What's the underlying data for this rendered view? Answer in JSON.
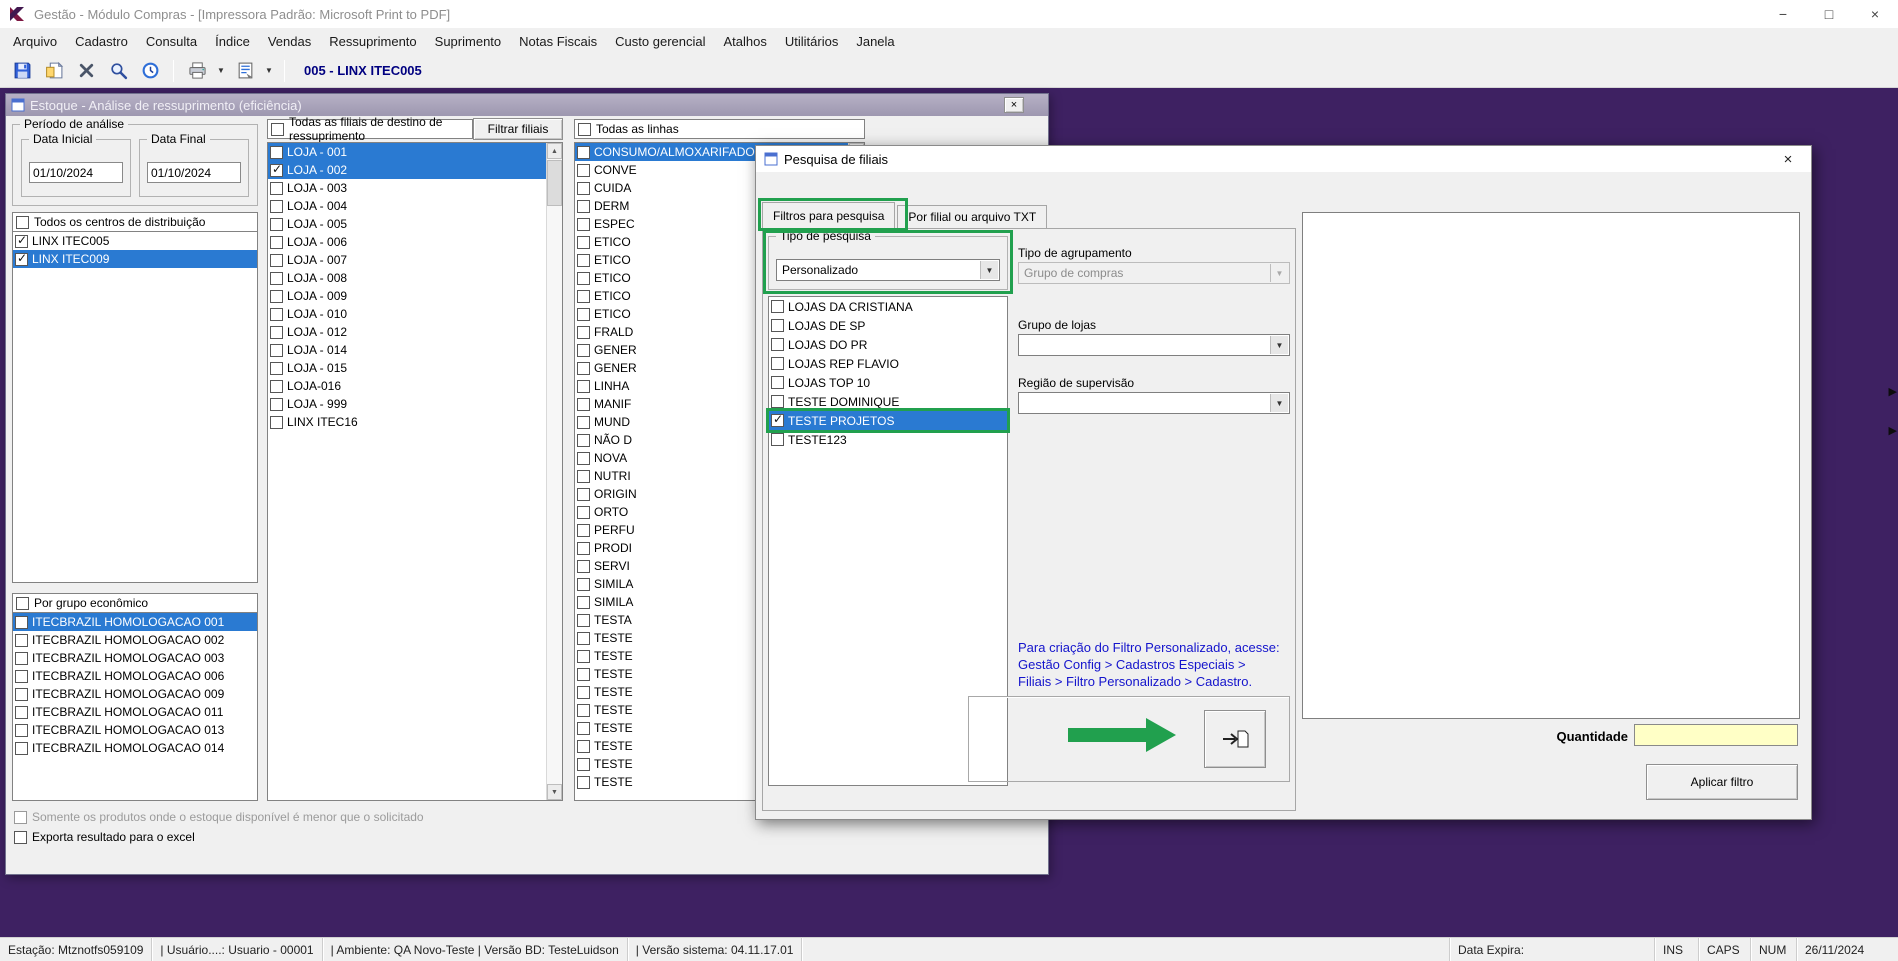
{
  "colors": {
    "accent_blue": "#2a7ad2",
    "annotation_green": "#21a04e",
    "desktop_purple": "#3e2162",
    "hint_blue": "#1414cc",
    "highlight_yellow": "#ffffc6"
  },
  "icons": {
    "minimize": "−",
    "maximize": "□",
    "close": "×",
    "scroll_up": "▲",
    "scroll_down": "▼",
    "dropdown": "▼",
    "edge_arrow": "▶"
  },
  "titlebar": {
    "title": "Gestão  - Módulo Compras - [Impressora Padrão: Microsoft Print to PDF]"
  },
  "menubar": {
    "items": [
      "Arquivo",
      "Cadastro",
      "Consulta",
      "Índice",
      "Vendas",
      "Ressuprimento",
      "Suprimento",
      "Notas Fiscais",
      "Custo gerencial",
      "Atalhos",
      "Utilitários",
      "Janela"
    ]
  },
  "toolbar": {
    "store_label": "005 - LINX ITEC005"
  },
  "analysis_dialog": {
    "title": "Estoque - Análise de ressuprimento (eficiência)",
    "periodo": {
      "group_label": "Período de análise",
      "data_inicial_label": "Data Inicial",
      "data_inicial_value": "01/10/2024",
      "data_final_label": "Data Final",
      "data_final_value": "01/10/2024"
    },
    "centros": {
      "header": "Todos os centros de distribuição",
      "items": [
        {
          "label": "LINX ITEC005",
          "checked": true
        },
        {
          "label": "LINX ITEC009",
          "checked": true,
          "selected": true
        }
      ]
    },
    "filiais": {
      "header": "Todas as filiais de destino de ressuprimento",
      "filter_button": "Filtrar filiais",
      "items": [
        {
          "label": "LOJA - 001",
          "selected": true
        },
        {
          "label": "LOJA - 002",
          "checked": true,
          "selected": true
        },
        {
          "label": "LOJA - 003"
        },
        {
          "label": "LOJA - 004"
        },
        {
          "label": "LOJA - 005"
        },
        {
          "label": "LOJA - 006"
        },
        {
          "label": "LOJA - 007"
        },
        {
          "label": "LOJA - 008"
        },
        {
          "label": "LOJA - 009"
        },
        {
          "label": "LOJA - 010"
        },
        {
          "label": "LOJA - 012"
        },
        {
          "label": "LOJA - 014"
        },
        {
          "label": "LOJA - 015"
        },
        {
          "label": "LOJA-016"
        },
        {
          "label": "LOJA - 999"
        },
        {
          "label": "LINX ITEC16"
        }
      ]
    },
    "linhas": {
      "header": "Todas as linhas",
      "items": [
        {
          "label": "CONSUMO/ALMOXARIFADO",
          "selected": true
        },
        {
          "label": "CONVE"
        },
        {
          "label": "CUIDA"
        },
        {
          "label": "DERM"
        },
        {
          "label": "ESPEC"
        },
        {
          "label": "ETICO"
        },
        {
          "label": "ETICO"
        },
        {
          "label": "ETICO"
        },
        {
          "label": "ETICO"
        },
        {
          "label": "ETICO"
        },
        {
          "label": "FRALD"
        },
        {
          "label": "GENER"
        },
        {
          "label": "GENER"
        },
        {
          "label": "LINHA"
        },
        {
          "label": "MANIF"
        },
        {
          "label": "MUND"
        },
        {
          "label": "NÃO D"
        },
        {
          "label": "NOVA"
        },
        {
          "label": "NUTRI"
        },
        {
          "label": "ORIGIN"
        },
        {
          "label": "ORTO"
        },
        {
          "label": "PERFU"
        },
        {
          "label": "PRODI"
        },
        {
          "label": "SERVI"
        },
        {
          "label": "SIMILA"
        },
        {
          "label": "SIMILA"
        },
        {
          "label": "TESTA"
        },
        {
          "label": "TESTE"
        },
        {
          "label": "TESTE"
        },
        {
          "label": "TESTE"
        },
        {
          "label": "TESTE"
        },
        {
          "label": "TESTE"
        },
        {
          "label": "TESTE"
        },
        {
          "label": "TESTE"
        },
        {
          "label": "TESTE"
        },
        {
          "label": "TESTE"
        }
      ]
    },
    "grupos": {
      "header": "Por grupo econômico",
      "items": [
        {
          "label": "ITECBRAZIL HOMOLOGACAO 001",
          "selected": true
        },
        {
          "label": "ITECBRAZIL HOMOLOGACAO 002"
        },
        {
          "label": "ITECBRAZIL HOMOLOGACAO 003"
        },
        {
          "label": "ITECBRAZIL HOMOLOGACAO 006"
        },
        {
          "label": "ITECBRAZIL HOMOLOGACAO 009"
        },
        {
          "label": "ITECBRAZIL HOMOLOGACAO 011"
        },
        {
          "label": "ITECBRAZIL HOMOLOGACAO 013"
        },
        {
          "label": "ITECBRAZIL HOMOLOGACAO 014"
        }
      ]
    },
    "footer": {
      "check1": "Somente os produtos onde o estoque disponível é menor que o solicitado",
      "check2": "Exporta resultado para o excel"
    }
  },
  "filter_dialog": {
    "title": "Pesquisa de filiais",
    "tabs": [
      {
        "label": "Filtros para pesquisa",
        "active": true
      },
      {
        "label": "Por filial ou arquivo TXT"
      }
    ],
    "tipo_pesquisa": {
      "group_label": "Tipo de pesquisa",
      "value": "Personalizado"
    },
    "filters": [
      {
        "label": "LOJAS DA CRISTIANA"
      },
      {
        "label": "LOJAS DE SP"
      },
      {
        "label": "LOJAS DO PR"
      },
      {
        "label": "LOJAS REP FLAVIO"
      },
      {
        "label": "LOJAS TOP 10"
      },
      {
        "label": "TESTE DOMINIQUE"
      },
      {
        "label": "TESTE PROJETOS",
        "checked": true,
        "selected": true,
        "annotated": true
      },
      {
        "label": "TESTE123"
      }
    ],
    "agrupamento_label": "Tipo de agrupamento",
    "agrupamento_value": "Grupo de compras",
    "grupo_lojas_label": "Grupo de lojas",
    "regiao_label": "Região de supervisão",
    "hint_line1": "Para criação do Filtro Personalizado, acesse:",
    "hint_line2": "Gestão Config > Cadastros Especiais >",
    "hint_line3": "Filiais > Filtro Personalizado > Cadastro.",
    "quantidade_label": "Quantidade",
    "aplicar_button": "Aplicar filtro"
  },
  "statusbar": {
    "sections": [
      "Estação: Mtznotfs059109",
      "| Usuário....: Usuario - 00001",
      "| Ambiente: QA Novo-Teste | Versão BD: TesteLuidson",
      "| Versão sistema: 04.11.17.01"
    ],
    "data_expira": "Data Expira:",
    "ins": "INS",
    "caps": "CAPS",
    "num": "NUM",
    "date": "26/11/2024"
  }
}
